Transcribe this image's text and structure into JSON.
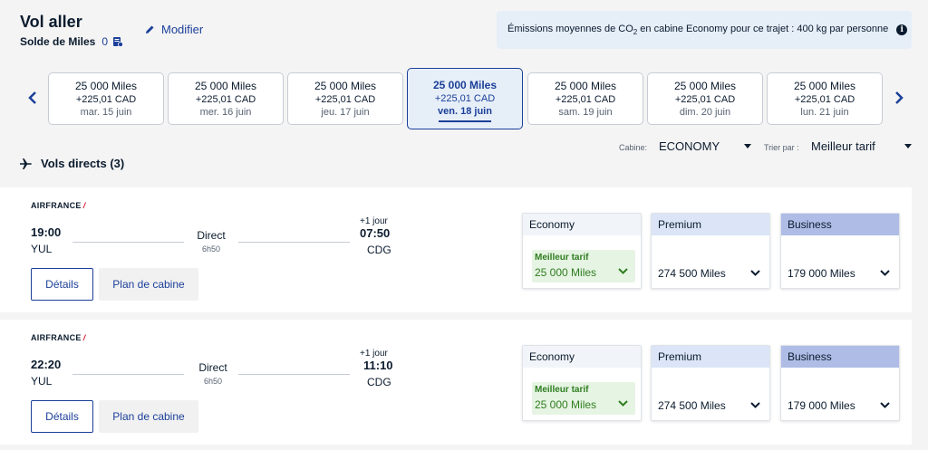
{
  "header": {
    "title": "Vol aller",
    "balance_label": "Solde de Miles",
    "balance_value": "0",
    "modify_label": "Modifier",
    "emissions_prefix": "Émissions moyennes de CO",
    "emissions_sub": "2",
    "emissions_suffix": " en cabine Economy pour ce trajet : 400 kg par personne"
  },
  "dates": [
    {
      "miles": "25 000  Miles",
      "cad": "+225,01 CAD",
      "day": "mar. 15 juin"
    },
    {
      "miles": "25 000  Miles",
      "cad": "+225,01 CAD",
      "day": "mer. 16 juin"
    },
    {
      "miles": "25 000  Miles",
      "cad": "+225,01 CAD",
      "day": "jeu. 17 juin"
    },
    {
      "miles": "25 000  Miles",
      "cad": "+225,01 CAD",
      "day": "ven. 18 juin"
    },
    {
      "miles": "25 000  Miles",
      "cad": "+225,01 CAD",
      "day": "sam. 19 juin"
    },
    {
      "miles": "25 000  Miles",
      "cad": "+225,01 CAD",
      "day": "dim. 20 juin"
    },
    {
      "miles": "25 000  Miles",
      "cad": "+225,01 CAD",
      "day": "lun. 21 juin"
    }
  ],
  "filters": {
    "section_title": "Vols directs (3)",
    "cabin_label": "Cabine:",
    "cabin_value": "ECONOMY",
    "sort_label": "Trier par :",
    "sort_value": "Meilleur tarif"
  },
  "flights": [
    {
      "airline": "AIRFRANCE",
      "dep_time": "19:00",
      "dep_airport": "YUL",
      "type": "Direct",
      "duration": "6h50",
      "day_offset": "+1 jour",
      "arr_time": "07:50",
      "arr_airport": "CDG",
      "details_label": "Détails",
      "cabin_plan_label": "Plan de cabine",
      "economy": {
        "name": "Economy",
        "best_label": "Meilleur tarif",
        "price": "25 000  Miles"
      },
      "premium": {
        "name": "Premium",
        "price": "274 500  Miles"
      },
      "business": {
        "name": "Business",
        "price": "179 000  Miles"
      }
    },
    {
      "airline": "AIRFRANCE",
      "dep_time": "22:20",
      "dep_airport": "YUL",
      "type": "Direct",
      "duration": "6h50",
      "day_offset": "+1 jour",
      "arr_time": "11:10",
      "arr_airport": "CDG",
      "details_label": "Détails",
      "cabin_plan_label": "Plan de cabine",
      "economy": {
        "name": "Economy",
        "best_label": "Meilleur tarif",
        "price": "25 000  Miles"
      },
      "premium": {
        "name": "Premium",
        "price": "274 500  Miles"
      },
      "business": {
        "name": "Business",
        "price": "179 000  Miles"
      }
    }
  ],
  "colors": {
    "brand_blue": "#1b3f99",
    "best_green": "#2f7d1f",
    "airline_red": "#d8192f"
  }
}
